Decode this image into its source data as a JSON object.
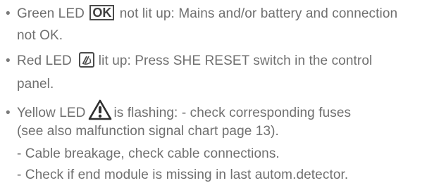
{
  "bullet_char": "•",
  "items": [
    {
      "before": "Green LED",
      "icon_text": "OK",
      "after": "not lit up: Mains and/or battery and connection",
      "cont": "not OK."
    },
    {
      "before": "Red LED",
      "icon_name": "reset-switch-icon",
      "after": "lit up: Press SHE RESET switch in the control",
      "cont": "panel."
    },
    {
      "before": "Yellow LED",
      "icon_name": "warning-triangle-icon",
      "after": "is flashing: - check corresponding fuses",
      "cont": "(see also malfunction signal chart page 13)."
    }
  ],
  "sub_items": [
    "- Cable breakage, check cable connections.",
    "- Check if end module is missing in last autom.detector."
  ]
}
